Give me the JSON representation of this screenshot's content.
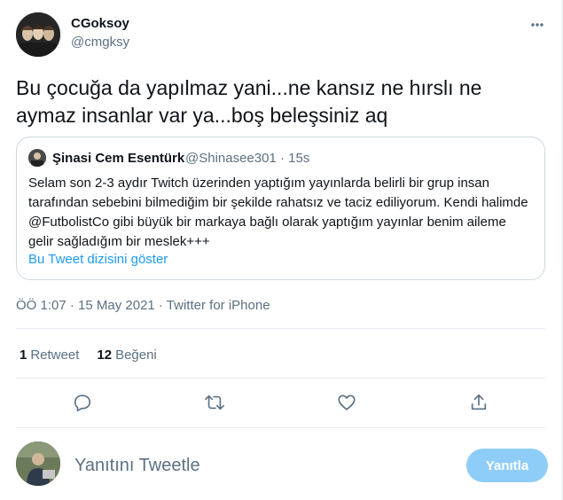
{
  "author": {
    "name": "CGoksoy",
    "handle": "@cmgksy"
  },
  "tweet": {
    "text": "Bu çocuğa da yapılmaz yani...ne kansız ne hırslı ne\naymaz insanlar var ya...boş beleşsiniz aq"
  },
  "quoted_tweet": {
    "name": "Şinasi Cem Esentürk",
    "handle_time": "@Shinasee301 · 15s",
    "body": "Selam son 2-3 aydır Twitch üzerinden yaptığım yayınlarda belirli bir grup insan tarafından sebebini bilmediğim bir şekilde rahatsız ve taciz ediliyorum. Kendi halimde @FutbolistCo gibi büyük bir markaya bağlı olarak yaptığım yayınlar benim aileme gelir sağladığım bir meslek+++",
    "thread_link": "Bu Tweet dizisini göster"
  },
  "timestamp": "ÖÖ 1:07 · 15 May 2021 · Twitter for iPhone",
  "stats": {
    "retweets_count": "1",
    "retweets_label": "Retweet",
    "likes_count": "12",
    "likes_label": "Beğeni"
  },
  "actions": {
    "icons": [
      "reply-icon",
      "retweet-icon",
      "like-icon",
      "share-icon"
    ]
  },
  "reply": {
    "placeholder": "Yanıtını Tweetle",
    "button_label": "Yanıtla"
  },
  "colors": {
    "accent": "#1d9bf0",
    "button_disabled": "#8ecdf8",
    "secondary_text": "#5b7083",
    "border": "#cfd9de"
  }
}
